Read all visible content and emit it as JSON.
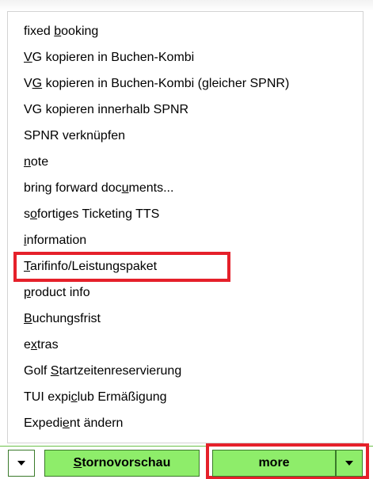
{
  "menu": {
    "items": [
      {
        "pre": "fixed ",
        "u": "b",
        "post": "ooking"
      },
      {
        "pre": "",
        "u": "V",
        "post": "G kopieren in Buchen-Kombi"
      },
      {
        "pre": "V",
        "u": "G",
        "post": " kopieren in Buchen-Kombi (gleicher SPNR)"
      },
      {
        "pre": "VG kopieren innerhalb SPNR",
        "u": "",
        "post": ""
      },
      {
        "pre": "SPNR verknüpfen",
        "u": "",
        "post": ""
      },
      {
        "pre": "",
        "u": "n",
        "post": "ote"
      },
      {
        "pre": "bring forward doc",
        "u": "u",
        "post": "ments..."
      },
      {
        "pre": "s",
        "u": "o",
        "post": "fortiges Ticketing TTS"
      },
      {
        "pre": "",
        "u": "i",
        "post": "nformation"
      },
      {
        "pre": "",
        "u": "T",
        "post": "arifinfo/Leistungspaket"
      },
      {
        "pre": "",
        "u": "p",
        "post": "roduct info"
      },
      {
        "pre": "",
        "u": "B",
        "post": "uchungsfrist"
      },
      {
        "pre": "e",
        "u": "x",
        "post": "tras"
      },
      {
        "pre": "Golf ",
        "u": "S",
        "post": "tartzeitenreservierung"
      },
      {
        "pre": "TUI expi",
        "u": "c",
        "post": "lub Ermäßigung"
      },
      {
        "pre": "Expedi",
        "u": "e",
        "post": "nt ändern"
      }
    ]
  },
  "bottom": {
    "storno_u": "S",
    "storno_rest": "tornovorschau",
    "more_label": "more"
  },
  "colors": {
    "button_green": "#8eed6a",
    "highlight_red": "#e5202a"
  }
}
